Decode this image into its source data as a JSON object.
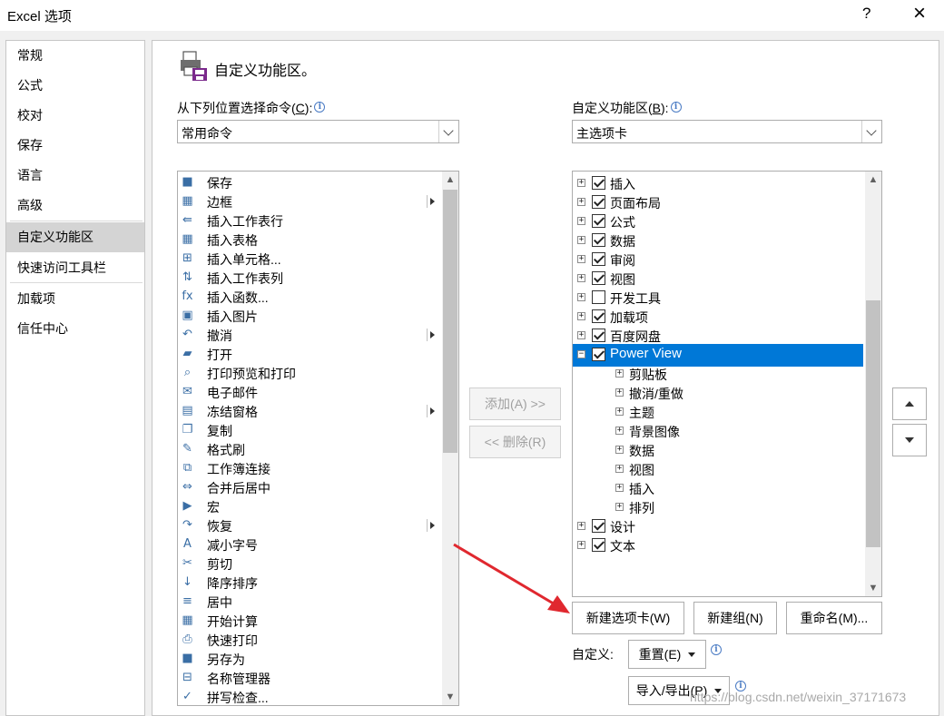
{
  "window": {
    "title": "Excel 选项",
    "help": "?",
    "close": "×"
  },
  "nav": {
    "items": [
      {
        "label": "常规",
        "active": false
      },
      {
        "label": "公式",
        "active": false
      },
      {
        "label": "校对",
        "active": false
      },
      {
        "label": "保存",
        "active": false
      },
      {
        "label": "语言",
        "active": false
      },
      {
        "label": "高级",
        "active": false
      },
      {
        "label": "自定义功能区",
        "active": true
      },
      {
        "label": "快速访问工具栏",
        "active": false
      },
      {
        "label": "加载项",
        "active": false
      },
      {
        "label": "信任中心",
        "active": false
      }
    ]
  },
  "header": {
    "title": "自定义功能区。"
  },
  "left": {
    "label_pre": "从下列位置选择命令(",
    "label_key": "C",
    "label_post": "):",
    "combo_value": "常用命令",
    "commands": [
      {
        "icon": "save-icon",
        "glyph": "■",
        "label": "保存",
        "sub": false
      },
      {
        "icon": "borders-icon",
        "glyph": "▦",
        "label": "边框",
        "sub": true
      },
      {
        "icon": "insert-rows-icon",
        "glyph": "⇚",
        "label": "插入工作表行",
        "sub": false
      },
      {
        "icon": "insert-table-icon",
        "glyph": "▦",
        "label": "插入表格",
        "sub": false
      },
      {
        "icon": "insert-cells-icon",
        "glyph": "⊞",
        "label": "插入单元格...",
        "sub": false
      },
      {
        "icon": "insert-columns-icon",
        "glyph": "⇅",
        "label": "插入工作表列",
        "sub": false
      },
      {
        "icon": "function-icon",
        "glyph": "fx",
        "label": "插入函数...",
        "sub": false
      },
      {
        "icon": "picture-icon",
        "glyph": "▣",
        "label": "插入图片",
        "sub": false
      },
      {
        "icon": "undo-icon",
        "glyph": "↶",
        "label": "撤消",
        "sub": true
      },
      {
        "icon": "open-folder-icon",
        "glyph": "▰",
        "label": "打开",
        "sub": false
      },
      {
        "icon": "print-preview-icon",
        "glyph": "⌕",
        "label": "打印预览和打印",
        "sub": false
      },
      {
        "icon": "email-icon",
        "glyph": "✉",
        "label": "电子邮件",
        "sub": false
      },
      {
        "icon": "freeze-panes-icon",
        "glyph": "▤",
        "label": "冻结窗格",
        "sub": true
      },
      {
        "icon": "copy-icon",
        "glyph": "❐",
        "label": "复制",
        "sub": false
      },
      {
        "icon": "format-painter-icon",
        "glyph": "✎",
        "label": "格式刷",
        "sub": false
      },
      {
        "icon": "workbook-connections-icon",
        "glyph": "⧉",
        "label": "工作簿连接",
        "sub": false
      },
      {
        "icon": "merge-center-icon",
        "glyph": "⇔",
        "label": "合并后居中",
        "sub": false
      },
      {
        "icon": "macro-icon",
        "glyph": "▶",
        "label": "宏",
        "sub": false
      },
      {
        "icon": "redo-icon",
        "glyph": "↷",
        "label": "恢复",
        "sub": true
      },
      {
        "icon": "decrease-font-icon",
        "glyph": "A",
        "label": "减小字号",
        "sub": false
      },
      {
        "icon": "cut-icon",
        "glyph": "✂",
        "label": "剪切",
        "sub": false
      },
      {
        "icon": "sort-descending-icon",
        "glyph": "↓",
        "label": "降序排序",
        "sub": false
      },
      {
        "icon": "center-icon",
        "glyph": "≡",
        "label": "居中",
        "sub": false
      },
      {
        "icon": "calculate-icon",
        "glyph": "▦",
        "label": "开始计算",
        "sub": false
      },
      {
        "icon": "quick-print-icon",
        "glyph": "⎙",
        "label": "快速打印",
        "sub": false
      },
      {
        "icon": "save-as-icon",
        "glyph": "■",
        "label": "另存为",
        "sub": false
      },
      {
        "icon": "name-manager-icon",
        "glyph": "⊟",
        "label": "名称管理器",
        "sub": false
      },
      {
        "icon": "spell-check-icon",
        "glyph": "✓",
        "label": "拼写检查...",
        "sub": false
      }
    ]
  },
  "right": {
    "label_pre": "自定义功能区(",
    "label_key": "B",
    "label_post": "):",
    "combo_value": "主选项卡",
    "tree": [
      {
        "label": "插入",
        "level": 0,
        "expander": "+",
        "checked": true,
        "selected": false
      },
      {
        "label": "页面布局",
        "level": 0,
        "expander": "+",
        "checked": true,
        "selected": false
      },
      {
        "label": "公式",
        "level": 0,
        "expander": "+",
        "checked": true,
        "selected": false
      },
      {
        "label": "数据",
        "level": 0,
        "expander": "+",
        "checked": true,
        "selected": false
      },
      {
        "label": "审阅",
        "level": 0,
        "expander": "+",
        "checked": true,
        "selected": false
      },
      {
        "label": "视图",
        "level": 0,
        "expander": "+",
        "checked": true,
        "selected": false
      },
      {
        "label": "开发工具",
        "level": 0,
        "expander": "+",
        "checked": false,
        "selected": false
      },
      {
        "label": "加载项",
        "level": 0,
        "expander": "+",
        "checked": true,
        "selected": false
      },
      {
        "label": "百度网盘",
        "level": 0,
        "expander": "+",
        "checked": true,
        "selected": false
      },
      {
        "label": "Power View",
        "level": 0,
        "expander": "−",
        "checked": true,
        "selected": true
      },
      {
        "label": "剪贴板",
        "level": 1,
        "expander": "+",
        "checked": null,
        "selected": false
      },
      {
        "label": "撤消/重做",
        "level": 1,
        "expander": "+",
        "checked": null,
        "selected": false
      },
      {
        "label": "主题",
        "level": 1,
        "expander": "+",
        "checked": null,
        "selected": false
      },
      {
        "label": "背景图像",
        "level": 1,
        "expander": "+",
        "checked": null,
        "selected": false
      },
      {
        "label": "数据",
        "level": 1,
        "expander": "+",
        "checked": null,
        "selected": false
      },
      {
        "label": "视图",
        "level": 1,
        "expander": "+",
        "checked": null,
        "selected": false
      },
      {
        "label": "插入",
        "level": 1,
        "expander": "+",
        "checked": null,
        "selected": false
      },
      {
        "label": "排列",
        "level": 1,
        "expander": "+",
        "checked": null,
        "selected": false
      },
      {
        "label": "设计",
        "level": 0,
        "expander": "+",
        "checked": true,
        "selected": false
      },
      {
        "label": "文本",
        "level": 0,
        "expander": "+",
        "checked": true,
        "selected": false
      }
    ]
  },
  "buttons": {
    "add": "添加(A) >>",
    "remove": "<< 删除(R)",
    "new_tab": "新建选项卡(W)",
    "new_group": "新建组(N)",
    "rename": "重命名(M)...",
    "customize_label": "自定义:",
    "reset": "重置(E)",
    "import_export": "导入/导出(P)"
  },
  "watermark": "https://blog.csdn.net/weixin_37171673",
  "colors": {
    "selection": "#0078d7",
    "annotation_arrow": "#e0282f"
  }
}
